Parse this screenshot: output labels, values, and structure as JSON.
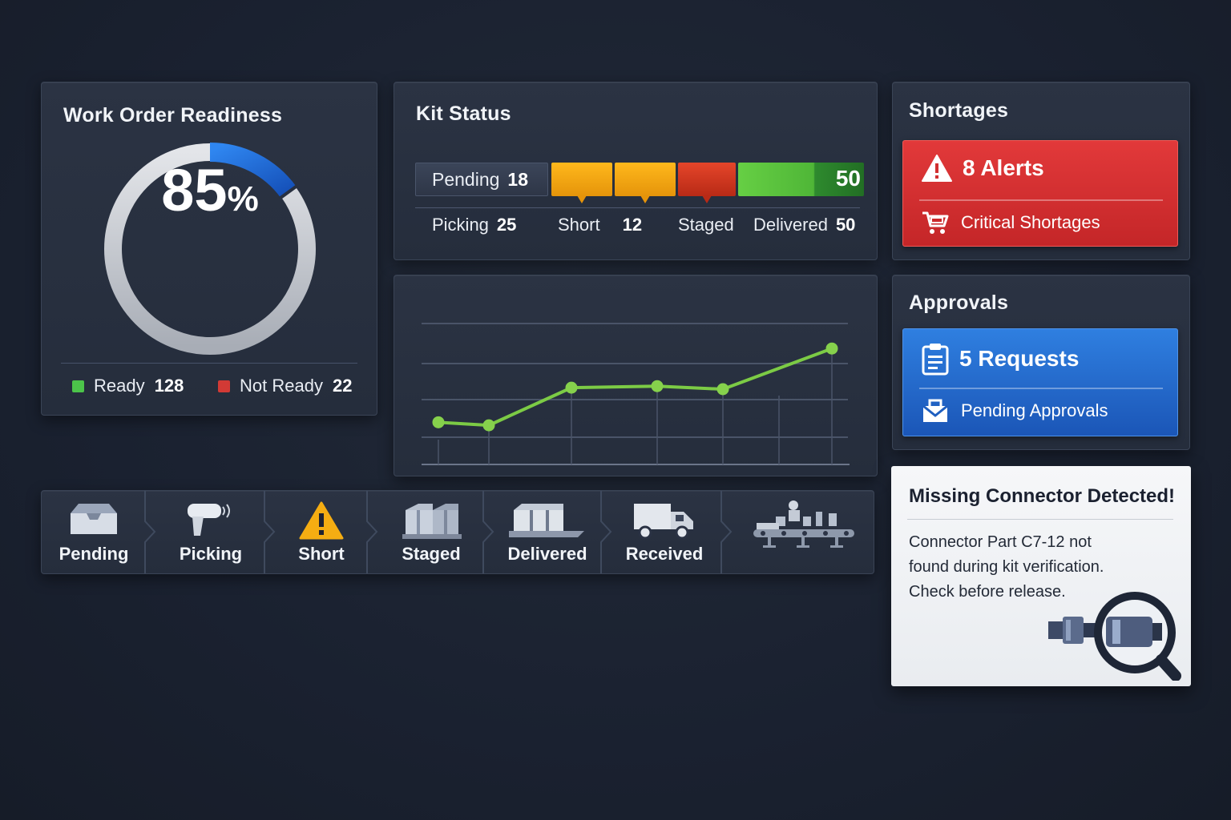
{
  "readiness": {
    "title": "Work Order Readiness",
    "percent_value": "85",
    "percent_sign": "%",
    "fraction": 0.85,
    "ready_label": "Ready",
    "ready_count": "128",
    "not_ready_label": "Not Ready",
    "not_ready_count": "22",
    "colors": {
      "ready": "#4cc44a",
      "not_ready": "#d23a35",
      "ring_progress": "#1f6fe0",
      "ring_track": "#c9ccd2"
    }
  },
  "kit_status": {
    "title": "Kit Status",
    "pending_label": "Pending",
    "pending_count": "18",
    "picking_label": "Picking",
    "picking_count": "25",
    "short_label": "Short",
    "short_count": "12",
    "staged_label": "Staged",
    "delivered_label": "Delivered",
    "delivered_count": "50",
    "delivered_bar_value": "50",
    "colors": {
      "picking": "#f2a60d",
      "short": "#f2a60d",
      "staged": "#d8391f",
      "delivered": "#5cc23f",
      "delivered_end": "#2a7a2a"
    }
  },
  "trend": {
    "chart_data": {
      "type": "line",
      "x": [
        1,
        2,
        3,
        4,
        5,
        6
      ],
      "values": [
        28,
        26,
        51,
        52,
        50,
        77
      ],
      "ylim": [
        0,
        100
      ],
      "grid": true,
      "color": "#7ccb45"
    }
  },
  "shortages": {
    "title": "Shortages",
    "alerts_label": "8 Alerts",
    "sub_label": "Critical Shortages",
    "icons": {
      "head": "warning-icon",
      "sub": "cart-icon"
    }
  },
  "approvals": {
    "title": "Approvals",
    "requests_label": "5 Requests",
    "sub_label": "Pending Approvals",
    "icons": {
      "head": "clipboard-icon",
      "sub": "inbox-icon"
    }
  },
  "notice": {
    "title": "Missing Connector Detected!",
    "lines": [
      "Connector Part C7-12 not",
      "found during kit verification.",
      "Check before release."
    ],
    "icon": "connector-magnifier-icon"
  },
  "workflow": {
    "steps": [
      {
        "label": "Pending",
        "icon": "box-icon"
      },
      {
        "label": "Picking",
        "icon": "scanner-icon"
      },
      {
        "label": "Short",
        "icon": "warning-icon"
      },
      {
        "label": "Staged",
        "icon": "pallet-icon"
      },
      {
        "label": "Delivered",
        "icon": "delivered-boxes-icon"
      },
      {
        "label": "Received",
        "icon": "truck-icon"
      },
      {
        "label": "",
        "icon": "assembly-line-icon"
      }
    ]
  }
}
